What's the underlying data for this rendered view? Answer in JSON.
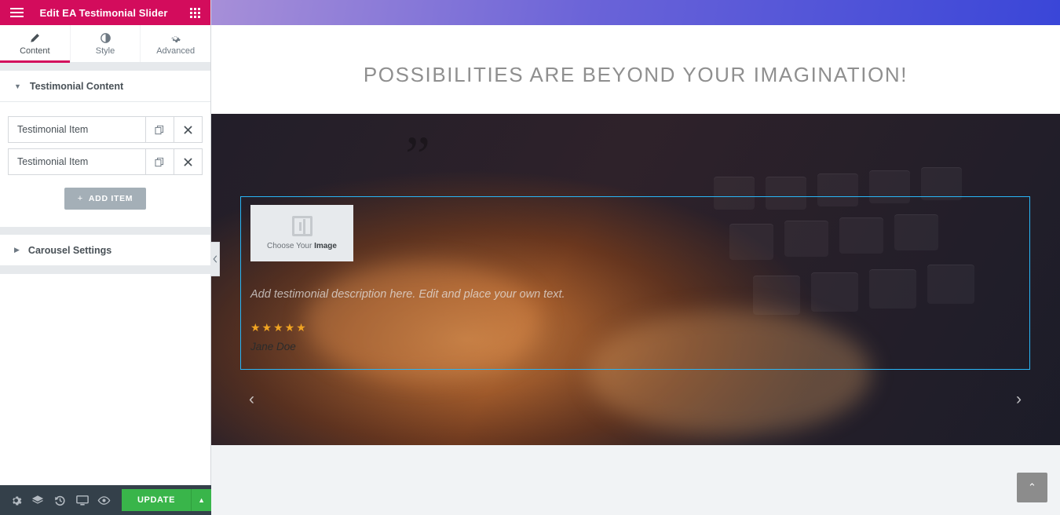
{
  "panel": {
    "header": {
      "title": "Edit EA Testimonial Slider",
      "menu_icon": "hamburger-menu-icon",
      "grid_icon": "widgets-grid-icon"
    },
    "tabs": [
      {
        "label": "Content",
        "icon": "pencil-icon",
        "active": true
      },
      {
        "label": "Style",
        "icon": "contrast-circle-icon",
        "active": false
      },
      {
        "label": "Advanced",
        "icon": "gear-icon",
        "active": false
      }
    ],
    "sections": [
      {
        "title": "Testimonial Content",
        "expanded": true
      },
      {
        "title": "Carousel Settings",
        "expanded": false
      }
    ],
    "repeater": {
      "items": [
        {
          "title": "Testimonial Item"
        },
        {
          "title": "Testimonial Item"
        }
      ],
      "duplicate_icon": "duplicate-icon",
      "remove_icon": "close-x-icon",
      "add_label": "ADD ITEM",
      "add_plus": "+"
    },
    "collapse_handle": "chevron-left-icon",
    "footer": {
      "icons": [
        "settings-gear-icon",
        "navigator-layers-icon",
        "history-revisions-icon",
        "responsive-mode-icon",
        "preview-eye-icon"
      ],
      "update_label": "UPDATE",
      "update_caret": "caret-up-icon"
    }
  },
  "preview": {
    "topbar_gradient_from": "#a78fd8",
    "topbar_gradient_to": "#3a46d8",
    "hero_title": "POSSIBILITIES ARE BEYOND YOUR IMAGINATION!",
    "quote_mark": "”",
    "selection_color": "#29b6f6",
    "testimonial": {
      "image_placeholder_text_lead": "Choose Your ",
      "image_placeholder_text_bold": "Image",
      "image_placeholder_icon": "elementor-image-placeholder-icon",
      "description": "Add testimonial description here. Edit and place your own text.",
      "stars": "★★★★★",
      "star_count": 5,
      "star_color": "#f0a422",
      "name": "Jane Doe"
    },
    "carousel": {
      "prev_icon": "chevron-left-icon",
      "next_icon": "chevron-right-icon",
      "prev_glyph": "‹",
      "next_glyph": "›",
      "dots": [
        {
          "active": true
        },
        {
          "active": false
        }
      ]
    },
    "scroll_top": {
      "icon": "chevron-up-icon",
      "glyph": "⌃"
    }
  }
}
